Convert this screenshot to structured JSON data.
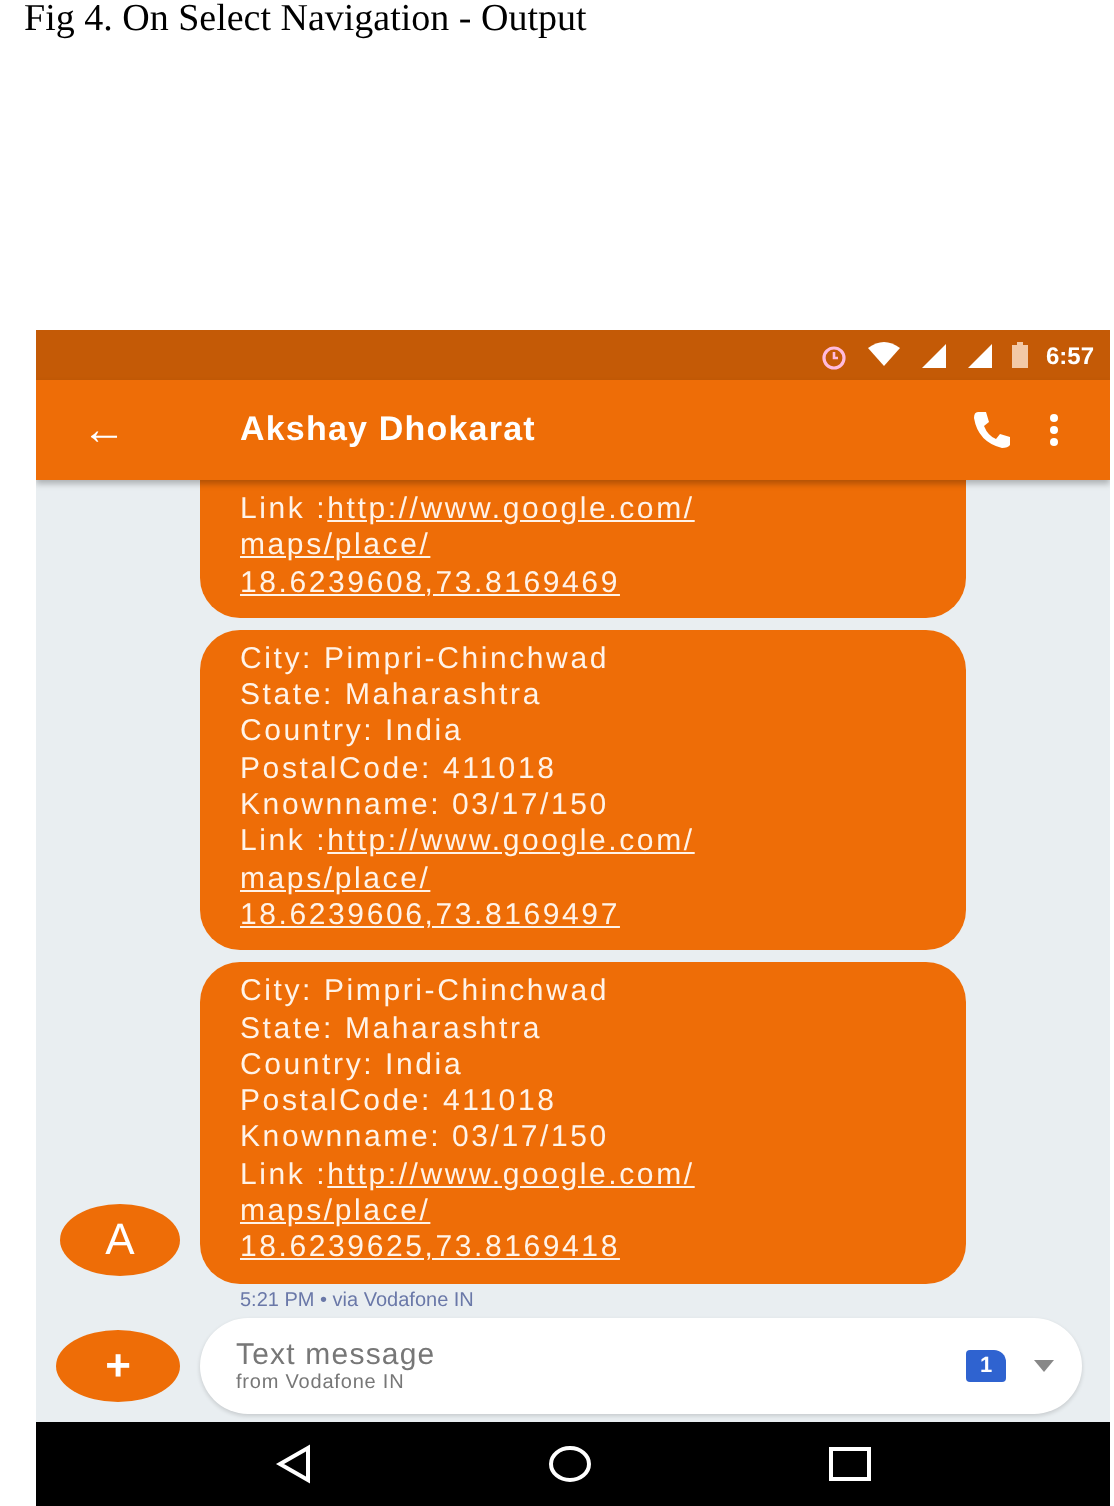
{
  "caption": "Fig 4. On Select Navigation - Output",
  "status_bar": {
    "time": "6:57"
  },
  "app_bar": {
    "back": "←",
    "title": "Akshay Dhokarat"
  },
  "messages": [
    {
      "link_label": "Link :",
      "link_parts": [
        "http://www.google.com/",
        "maps/place/",
        "18.6239608,73.8169469"
      ],
      "cut_top": true
    },
    {
      "lines": [
        "City: Pimpri-Chinchwad",
        "State: Maharashtra",
        "Country: India",
        "PostalCode: 411018",
        "Knownname: 03/17/150"
      ],
      "link_label": "Link :",
      "link_parts": [
        "http://www.google.com/",
        "maps/place/",
        "18.6239606,73.8169497"
      ],
      "cut_top": false
    },
    {
      "lines": [
        "City: Pimpri-Chinchwad",
        "State: Maharashtra",
        "Country: India",
        "PostalCode: 411018",
        "Knownname: 03/17/150"
      ],
      "link_label": "Link :",
      "link_parts": [
        "http://www.google.com/",
        "maps/place/",
        "18.6239625,73.8169418"
      ],
      "cut_top": false,
      "avatar": "A"
    }
  ],
  "message_meta": "5:21 PM • via Vodafone IN",
  "compose": {
    "add": "+",
    "placeholder": "Text message",
    "sub_hint": "from Vodafone IN",
    "sim": "1"
  }
}
